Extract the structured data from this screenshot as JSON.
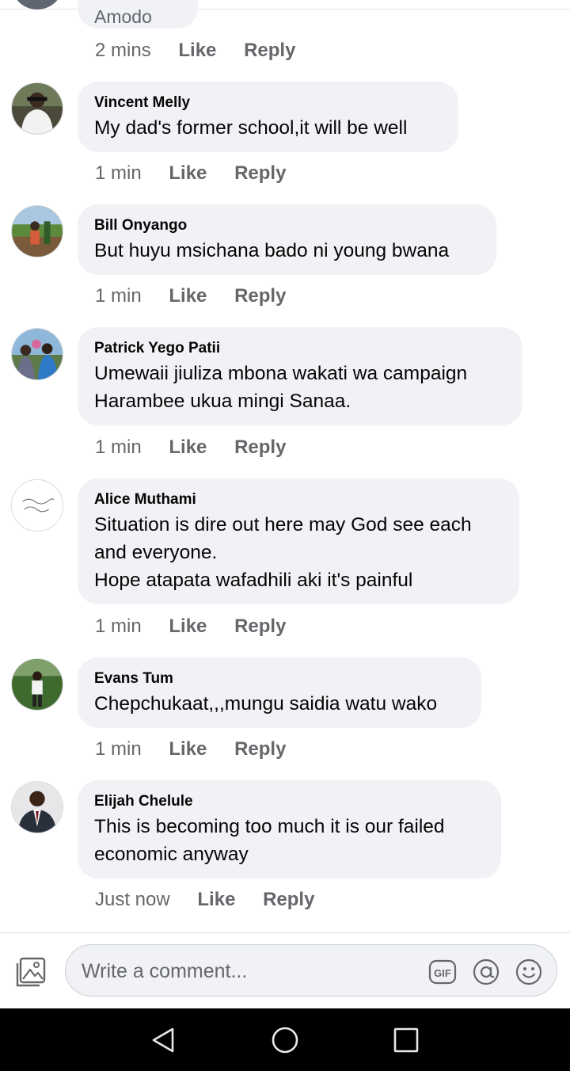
{
  "comments": [
    {
      "author": "",
      "text": "Amodo",
      "time": "2 mins",
      "like": "Like",
      "reply": "Reply"
    },
    {
      "author": "Vincent Melly",
      "text": "My dad's former school,it will be well",
      "time": "1 min",
      "like": "Like",
      "reply": "Reply"
    },
    {
      "author": "Bill Onyango",
      "text": "But huyu msichana bado ni young bwana",
      "time": "1 min",
      "like": "Like",
      "reply": "Reply"
    },
    {
      "author": "Patrick Yego Patii",
      "text": "Umewaii jiuliza mbona wakati wa campaign\nHarambee ukua mingi Sanaa.",
      "time": "1 min",
      "like": "Like",
      "reply": "Reply"
    },
    {
      "author": "Alice Muthami",
      "text": "Situation is dire out here may God see each\nand everyone.\nHope atapata wafadhili aki it's painful",
      "time": "1 min",
      "like": "Like",
      "reply": "Reply"
    },
    {
      "author": "Evans Tum",
      "text": "Chepchukaat,,,mungu saidia watu wako",
      "time": "1 min",
      "like": "Like",
      "reply": "Reply"
    },
    {
      "author": "Elijah Chelule",
      "text": "This is becoming too much it is our failed\neconomic anyway",
      "time": "Just now",
      "like": "Like",
      "reply": "Reply"
    }
  ],
  "composer": {
    "placeholder": "Write a comment...",
    "gif_label": "GIF"
  },
  "icons": {
    "photo": "photo-icon",
    "gif": "gif-icon",
    "mention": "at-icon",
    "emoji": "emoji-icon",
    "back": "back-icon",
    "home": "home-icon",
    "recents": "recents-icon"
  },
  "colors": {
    "bubble": "#f0f2f5",
    "meta_text": "#65676b",
    "nav_bar": "#000000"
  }
}
